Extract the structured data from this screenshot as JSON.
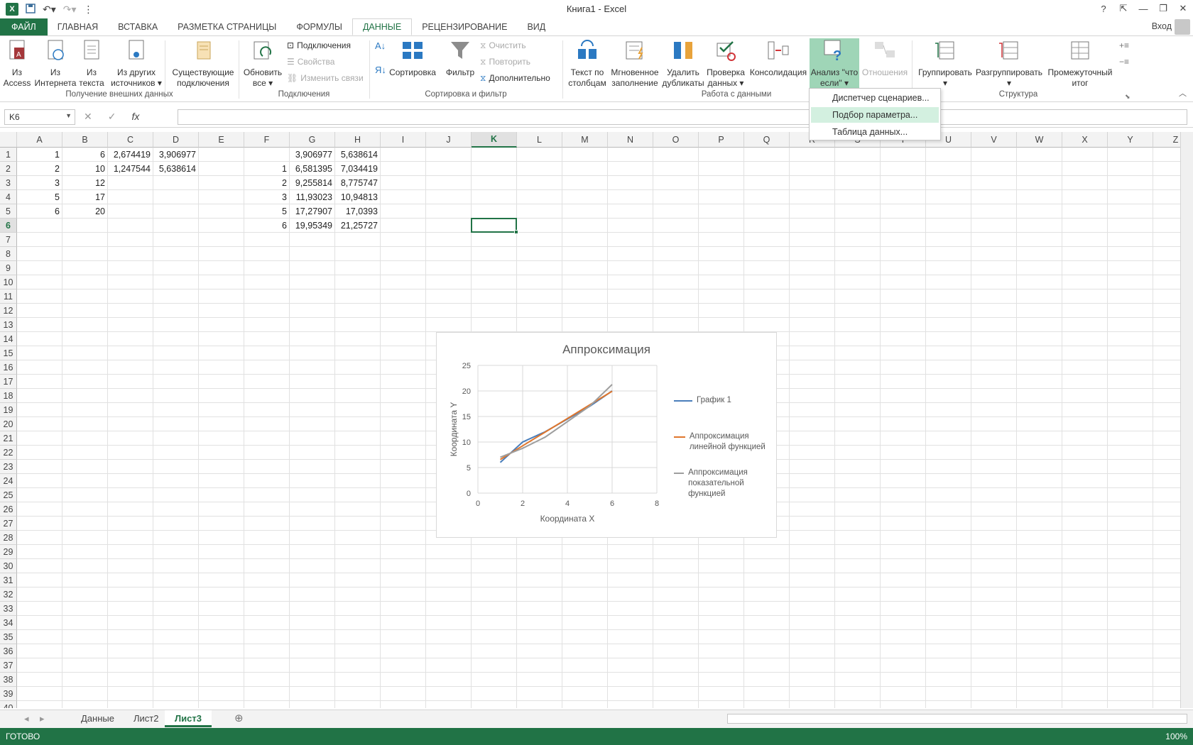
{
  "window": {
    "title": "Книга1 - Excel",
    "help": "?",
    "ribbon_toggle": "⇱",
    "minimize": "—",
    "restore": "❐",
    "close": "✕"
  },
  "qat": {
    "save_icon": "save-icon",
    "undo_icon": "undo-icon",
    "redo_icon": "redo-icon"
  },
  "tabs": {
    "file": "ФАЙЛ",
    "home": "ГЛАВНАЯ",
    "insert": "ВСТАВКА",
    "layout": "РАЗМЕТКА СТРАНИЦЫ",
    "formulas": "ФОРМУЛЫ",
    "data": "ДАННЫЕ",
    "review": "РЕЦЕНЗИРОВАНИЕ",
    "view": "ВИД"
  },
  "signin": "Вход",
  "ribbon": {
    "access": "Из\nAccess",
    "web": "Из\nИнтернета",
    "text": "Из\nтекста",
    "other": "Из других\nисточников ▾",
    "existing": "Существующие\nподключения",
    "group_external": "Получение внешних данных",
    "refresh": "Обновить\nвсе ▾",
    "connections": "Подключения",
    "properties": "Свойства",
    "edit_links": "Изменить связи",
    "group_connections": "Подключения",
    "sort": "Сортировка",
    "filter": "Фильтр",
    "clear": "Очистить",
    "reapply": "Повторить",
    "advanced": "Дополнительно",
    "group_sort": "Сортировка и фильтр",
    "text_to_cols": "Текст по\nстолбцам",
    "flash_fill": "Мгновенное\nзаполнение",
    "remove_dup": "Удалить\nдубликаты",
    "validation": "Проверка\nданных ▾",
    "consolidate": "Консолидация",
    "whatif": "Анализ \"что\nесли\" ▾",
    "relationships": "Отношения",
    "group_datatools": "Работа с данными",
    "group": "Группировать\n▾",
    "ungroup": "Разгруппировать\n▾",
    "subtotal": "Промежуточный\nитог",
    "group_outline": "Структура"
  },
  "formula_bar": {
    "name_box": "K6",
    "fx": "fx",
    "cancel": "✕",
    "enter": "✓",
    "value": ""
  },
  "columns": [
    "A",
    "B",
    "C",
    "D",
    "E",
    "F",
    "G",
    "H",
    "I",
    "J",
    "K",
    "L",
    "M",
    "N",
    "O",
    "P",
    "Q",
    "R",
    "S",
    "T",
    "U",
    "V",
    "W",
    "X",
    "Y",
    "Z"
  ],
  "rows": [
    "1",
    "2",
    "3",
    "4",
    "5",
    "6",
    "7",
    "8",
    "9",
    "10",
    "11",
    "12",
    "13",
    "14",
    "15",
    "16",
    "17",
    "18",
    "19",
    "20",
    "21",
    "22",
    "23",
    "24",
    "25",
    "26",
    "27",
    "28",
    "29",
    "30",
    "31",
    "32",
    "33",
    "34",
    "35",
    "36",
    "37",
    "38",
    "39",
    "40"
  ],
  "cells": {
    "A1": "1",
    "B1": "6",
    "C1": "2,674419",
    "D1": "3,906977",
    "G1": "3,906977",
    "H1": "5,638614",
    "A2": "2",
    "B2": "10",
    "C2": "1,247544",
    "D2": "5,638614",
    "F2": "1",
    "G2": "6,581395",
    "H2": "7,034419",
    "A3": "3",
    "B3": "12",
    "F3": "2",
    "G3": "9,255814",
    "H3": "8,775747",
    "A4": "5",
    "B4": "17",
    "F4": "3",
    "G4": "11,93023",
    "H4": "10,94813",
    "A5": "6",
    "B5": "20",
    "F5": "5",
    "G5": "17,27907",
    "H5": "17,0393",
    "F6": "6",
    "G6": "19,95349",
    "H6": "21,25727"
  },
  "menu": {
    "scenario": "Диспетчер сценариев...",
    "goal_seek": "Подбор параметра...",
    "data_table": "Таблица данных..."
  },
  "chart_data": {
    "type": "line",
    "title": "Аппроксимация",
    "xlabel": "Координата X",
    "ylabel": "Координата Y",
    "xlim": [
      0,
      8
    ],
    "ylim": [
      0,
      25
    ],
    "xticks": [
      "0",
      "2",
      "4",
      "6",
      "8"
    ],
    "yticks": [
      "0",
      "5",
      "10",
      "15",
      "20",
      "25"
    ],
    "grid": "vertical and horizontal",
    "legend": "right",
    "series": [
      {
        "name": "График 1",
        "color": "#4a7ebb",
        "x": [
          1,
          2,
          3,
          5,
          6
        ],
        "y": [
          6,
          10,
          12,
          17,
          20
        ]
      },
      {
        "name": "Аппроксимация линейной функцией",
        "color": "#e0762c",
        "x": [
          1,
          2,
          3,
          5,
          6
        ],
        "y": [
          6.58,
          9.26,
          11.93,
          17.28,
          19.95
        ]
      },
      {
        "name": "Аппроксимация показательной функцией",
        "color": "#9e9e9e",
        "x": [
          1,
          2,
          3,
          5,
          6
        ],
        "y": [
          7.03,
          8.78,
          10.95,
          17.04,
          21.26
        ]
      }
    ]
  },
  "sheets": [
    "Данные",
    "Лист2",
    "Лист3"
  ],
  "status": {
    "ready": "ГОТОВО",
    "zoom": "100%"
  }
}
